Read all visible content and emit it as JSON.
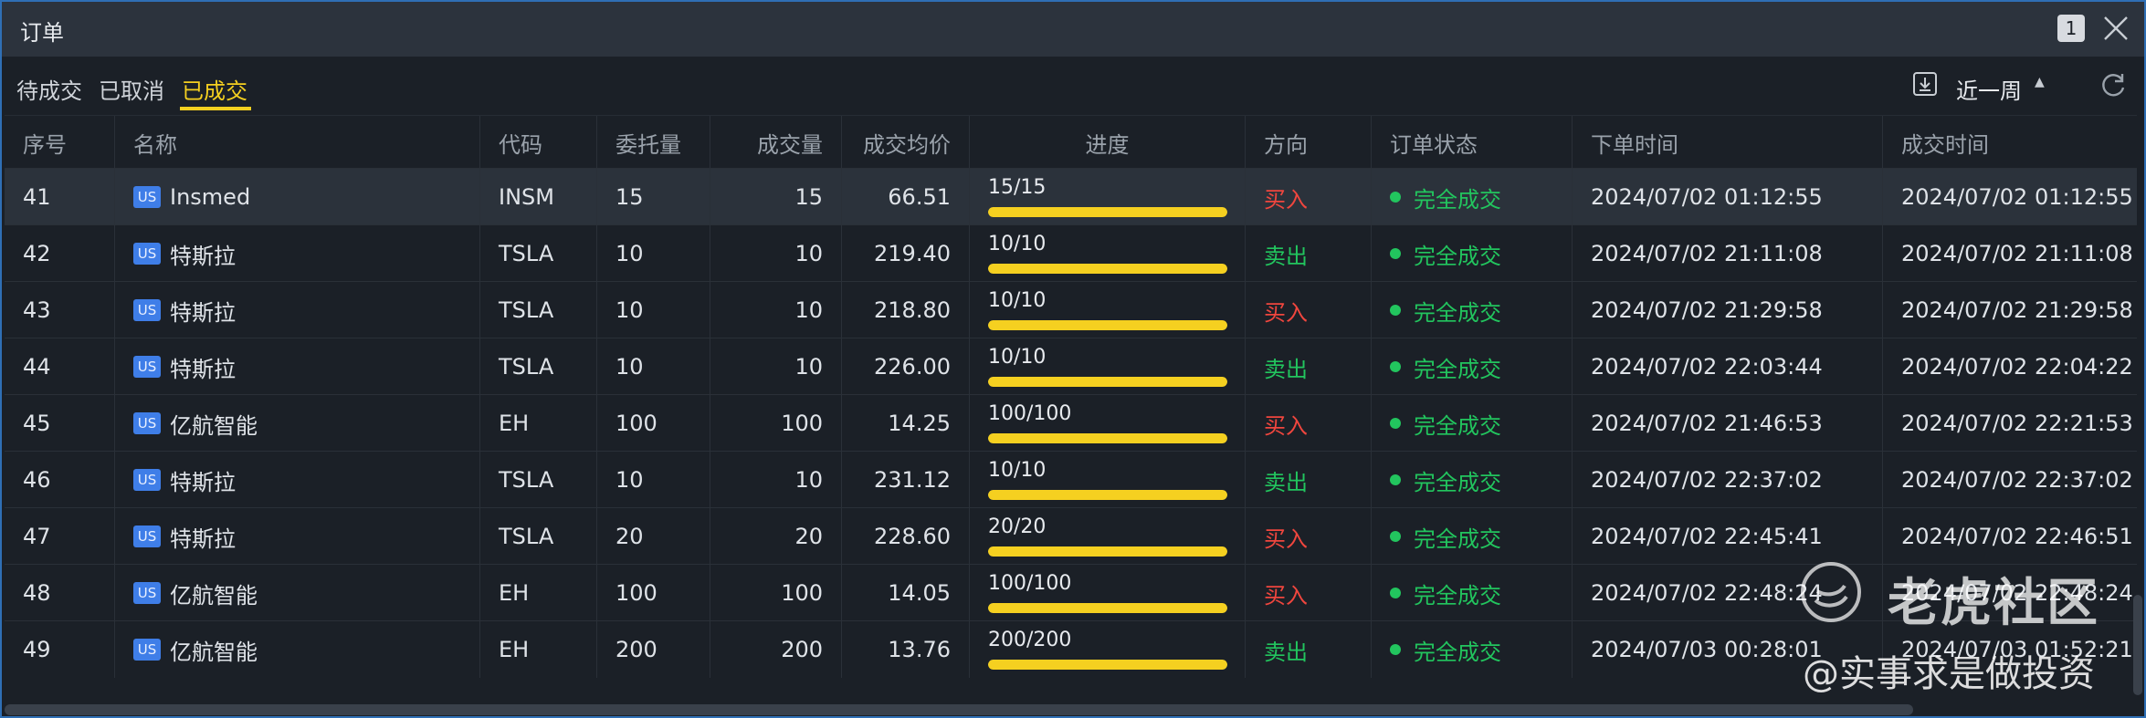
{
  "window": {
    "title": "订单",
    "badge": "1"
  },
  "tabs": [
    {
      "label": "待成交",
      "active": false
    },
    {
      "label": "已取消",
      "active": false
    },
    {
      "label": "已成交",
      "active": true
    }
  ],
  "toolbar": {
    "period_label": "近一周"
  },
  "columns": [
    "序号",
    "名称",
    "代码",
    "委托量",
    "成交量",
    "成交均价",
    "进度",
    "方向",
    "订单状态",
    "下单时间",
    "成交时间"
  ],
  "rows": [
    {
      "no": "41",
      "market": "US",
      "name": "Insmed",
      "code": "INSM",
      "order_qty": "15",
      "filled_qty": "15",
      "avg_price": "66.51",
      "progress": "15/15",
      "progress_pct": 100,
      "direction": "买入",
      "side": "buy",
      "status": "完全成交",
      "order_time": "2024/07/02 01:12:55",
      "fill_time": "2024/07/02 01:12:55",
      "selected": true
    },
    {
      "no": "42",
      "market": "US",
      "name": "特斯拉",
      "code": "TSLA",
      "order_qty": "10",
      "filled_qty": "10",
      "avg_price": "219.40",
      "progress": "10/10",
      "progress_pct": 100,
      "direction": "卖出",
      "side": "sell",
      "status": "完全成交",
      "order_time": "2024/07/02 21:11:08",
      "fill_time": "2024/07/02 21:11:08"
    },
    {
      "no": "43",
      "market": "US",
      "name": "特斯拉",
      "code": "TSLA",
      "order_qty": "10",
      "filled_qty": "10",
      "avg_price": "218.80",
      "progress": "10/10",
      "progress_pct": 100,
      "direction": "买入",
      "side": "buy",
      "status": "完全成交",
      "order_time": "2024/07/02 21:29:58",
      "fill_time": "2024/07/02 21:29:58"
    },
    {
      "no": "44",
      "market": "US",
      "name": "特斯拉",
      "code": "TSLA",
      "order_qty": "10",
      "filled_qty": "10",
      "avg_price": "226.00",
      "progress": "10/10",
      "progress_pct": 100,
      "direction": "卖出",
      "side": "sell",
      "status": "完全成交",
      "order_time": "2024/07/02 22:03:44",
      "fill_time": "2024/07/02 22:04:22"
    },
    {
      "no": "45",
      "market": "US",
      "name": "亿航智能",
      "code": "EH",
      "order_qty": "100",
      "filled_qty": "100",
      "avg_price": "14.25",
      "progress": "100/100",
      "progress_pct": 100,
      "direction": "买入",
      "side": "buy",
      "status": "完全成交",
      "order_time": "2024/07/02 21:46:53",
      "fill_time": "2024/07/02 22:21:53"
    },
    {
      "no": "46",
      "market": "US",
      "name": "特斯拉",
      "code": "TSLA",
      "order_qty": "10",
      "filled_qty": "10",
      "avg_price": "231.12",
      "progress": "10/10",
      "progress_pct": 100,
      "direction": "卖出",
      "side": "sell",
      "status": "完全成交",
      "order_time": "2024/07/02 22:37:02",
      "fill_time": "2024/07/02 22:37:02"
    },
    {
      "no": "47",
      "market": "US",
      "name": "特斯拉",
      "code": "TSLA",
      "order_qty": "20",
      "filled_qty": "20",
      "avg_price": "228.60",
      "progress": "20/20",
      "progress_pct": 100,
      "direction": "买入",
      "side": "buy",
      "status": "完全成交",
      "order_time": "2024/07/02 22:45:41",
      "fill_time": "2024/07/02 22:46:51"
    },
    {
      "no": "48",
      "market": "US",
      "name": "亿航智能",
      "code": "EH",
      "order_qty": "100",
      "filled_qty": "100",
      "avg_price": "14.05",
      "progress": "100/100",
      "progress_pct": 100,
      "direction": "买入",
      "side": "buy",
      "status": "完全成交",
      "order_time": "2024/07/02 22:48:24",
      "fill_time": "2024/07/02 22:48:24"
    },
    {
      "no": "49",
      "market": "US",
      "name": "亿航智能",
      "code": "EH",
      "order_qty": "200",
      "filled_qty": "200",
      "avg_price": "13.76",
      "progress": "200/200",
      "progress_pct": 100,
      "direction": "卖出",
      "side": "sell",
      "status": "完全成交",
      "order_time": "2024/07/03 00:28:01",
      "fill_time": "2024/07/03 01:52:21"
    }
  ],
  "watermark": {
    "brand": "老虎社区",
    "handle": "@实事求是做投资"
  },
  "colors": {
    "accent": "#f5d020",
    "buy": "#f0463e",
    "sell": "#22c55e",
    "badge": "#3f7ee8"
  }
}
